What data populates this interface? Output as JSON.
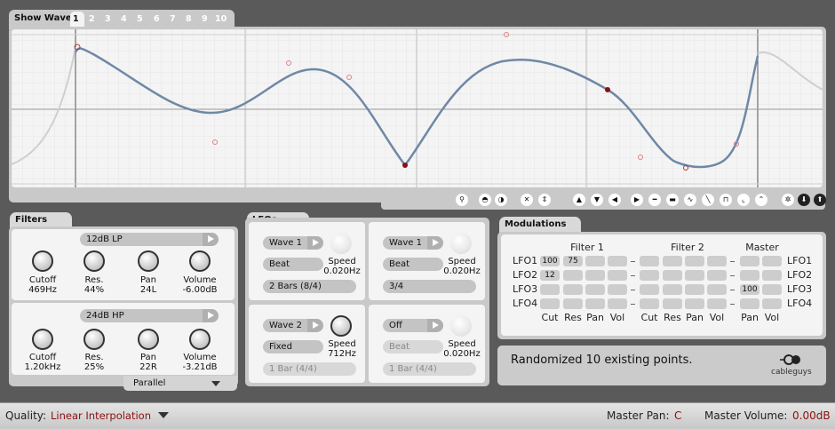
{
  "show_wave": {
    "label": "Show Wave:",
    "tabs": [
      "1",
      "2",
      "3",
      "4",
      "5",
      "6",
      "7",
      "8",
      "9",
      "10"
    ],
    "active": "1"
  },
  "toolbar_icons": [
    "zoom-icon",
    "half-circle-top-icon",
    "half-circle-right-icon",
    "close-circle-icon",
    "up-down-arrows-icon",
    "arrow-up-icon",
    "arrow-down-icon",
    "arrow-left-icon",
    "arrow-right-icon",
    "shape-flat-icon",
    "shape-step-icon",
    "shape-saw-icon",
    "shape-ramp-icon",
    "shape-square-icon",
    "shape-curve-icon",
    "shape-peak-icon",
    "randomize-icon",
    "wave-load-icon",
    "wave-save-icon"
  ],
  "filters": {
    "title": "Filters",
    "filter1": {
      "type": "12dB LP",
      "knobs": [
        {
          "label": "Cutoff",
          "value": "469Hz"
        },
        {
          "label": "Res.",
          "value": "44%"
        },
        {
          "label": "Pan",
          "value": "24L"
        },
        {
          "label": "Volume",
          "value": "-6.00dB"
        }
      ]
    },
    "filter2": {
      "type": "24dB HP",
      "knobs": [
        {
          "label": "Cutoff",
          "value": "1.20kHz"
        },
        {
          "label": "Res.",
          "value": "25%"
        },
        {
          "label": "Pan",
          "value": "22R"
        },
        {
          "label": "Volume",
          "value": "-3.21dB"
        }
      ]
    },
    "routing": "Parallel"
  },
  "lfos": {
    "title": "LFOs",
    "items": [
      {
        "wave": "Wave 1",
        "mode": "Beat",
        "speed_label": "Speed",
        "speed": "0.020Hz",
        "length": "2 Bars (8/4)"
      },
      {
        "wave": "Wave 1",
        "mode": "Beat",
        "speed_label": "Speed",
        "speed": "0.020Hz",
        "length": "3/4"
      },
      {
        "wave": "Wave 2",
        "mode": "Fixed",
        "speed_label": "Speed",
        "speed": "712Hz",
        "length": "1 Bar (4/4)"
      },
      {
        "wave": "Off",
        "mode": "Beat",
        "speed_label": "Speed",
        "speed": "0.020Hz",
        "length": "1 Bar (4/4)"
      }
    ]
  },
  "modulations": {
    "title": "Modulations",
    "groups": [
      "Filter 1",
      "Filter 2",
      "Master"
    ],
    "rows": [
      "LFO1",
      "LFO2",
      "LFO3",
      "LFO4"
    ],
    "cols": [
      "Cut",
      "Res",
      "Pan",
      "Vol",
      "Cut",
      "Res",
      "Pan",
      "Vol",
      "Pan",
      "Vol"
    ],
    "values": [
      [
        "100",
        "75",
        "",
        "",
        "",
        "",
        "",
        "",
        "",
        ""
      ],
      [
        "12",
        "",
        "",
        "",
        "",
        "",
        "",
        "",
        "",
        ""
      ],
      [
        "",
        "",
        "",
        "",
        "",
        "",
        "",
        "",
        "100",
        ""
      ],
      [
        "",
        "",
        "",
        "",
        "",
        "",
        "",
        "",
        "",
        ""
      ]
    ]
  },
  "status": {
    "message": "Randomized 10 existing points.",
    "logo": "cableguys"
  },
  "bottom": {
    "quality_label": "Quality:",
    "quality_value": "Linear Interpolation",
    "master_pan_label": "Master Pan:",
    "master_pan_value": "C",
    "master_volume_label": "Master Volume:",
    "master_volume_value": "0.00dB"
  },
  "colors": {
    "wave": "#6f88a6",
    "ghost": "#cfcfcf",
    "point": "#8b1010",
    "handle": "#e08080",
    "value_text": "#8b1010"
  }
}
